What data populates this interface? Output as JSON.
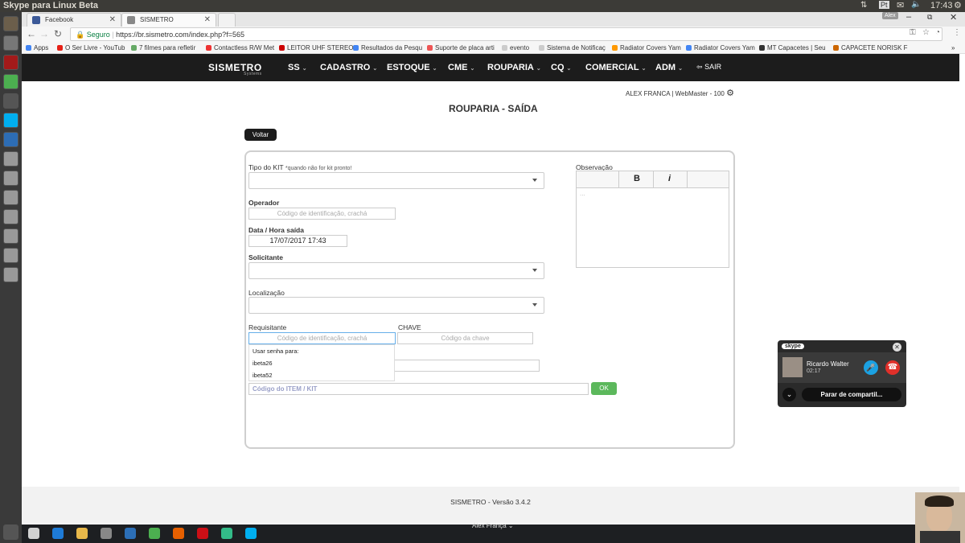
{
  "window_title": "Skype para Linux Beta",
  "top_panel": {
    "time": "17:43"
  },
  "tabs": [
    {
      "label": "Facebook"
    },
    {
      "label": "SISMETRO"
    }
  ],
  "address": {
    "secure_label": "Seguro",
    "url": "https://br.sismetro.com/index.php?f=565"
  },
  "bookmarks": [
    {
      "label": "Apps"
    },
    {
      "label": "O Ser Livre - YouTub"
    },
    {
      "label": "7 filmes para refletir"
    },
    {
      "label": "Contactless R/W Met"
    },
    {
      "label": "LEITOR UHF STEREO"
    },
    {
      "label": "Resultados da Pesqu"
    },
    {
      "label": "Suporte de placa arti"
    },
    {
      "label": "evento"
    },
    {
      "label": "Sistema de Notificaç"
    },
    {
      "label": "Radiator Covers Yam"
    },
    {
      "label": "Radiator Covers Yam"
    },
    {
      "label": "MT Capacetes | Seu"
    },
    {
      "label": "CAPACETE NORISK F"
    }
  ],
  "site": {
    "logo": "SISMETRO",
    "logo_sub": "Systems",
    "menu": [
      {
        "label": "SS"
      },
      {
        "label": "CADASTRO"
      },
      {
        "label": "ESTOQUE"
      },
      {
        "label": "CME"
      },
      {
        "label": "ROUPARIA"
      },
      {
        "label": "CQ"
      },
      {
        "label": "COMERCIAL"
      },
      {
        "label": "ADM"
      }
    ],
    "logout": "SAIR",
    "user_info": "ALEX FRANCA | WebMaster - 100"
  },
  "page": {
    "title": "ROUPARIA - SAÍDA",
    "back_button": "Voltar"
  },
  "form": {
    "tipo_kit_label": "Tipo do KIT",
    "tipo_kit_hint": "*quando não for kit pronto!",
    "operador_label": "Operador",
    "operador_placeholder": "Código de identificação, crachá",
    "data_label": "Data / Hora saída",
    "data_value": "17/07/2017 17:43",
    "solicitante_label": "Solicitante",
    "localizacao_label": "Localização",
    "requisitante_label": "Requisitante",
    "requisitante_placeholder": "Código de identificação, crachá",
    "chave_label": "CHAVE",
    "chave_placeholder": "Código da chave",
    "item_placeholder": "Código do ITEM / KIT",
    "ok_button": "OK",
    "observacao_label": "Observação",
    "bold_btn": "B",
    "italic_btn": "i",
    "editor_placeholder": "..."
  },
  "autocomplete": [
    {
      "label": "Usar senha para:"
    },
    {
      "label": "ibeta26"
    },
    {
      "label": "ibeta52"
    }
  ],
  "footer": {
    "text": "SISMETRO - Versão 3.4.2"
  },
  "skype": {
    "brand": "skype",
    "caller": "Ricardo Walter",
    "duration": "02:17",
    "stop_share": "Parar de compartil..."
  },
  "taskbar": {
    "user": "Alex França"
  },
  "colors": {
    "nav_bg": "#1c1c1c",
    "ok_green": "#5cb85c",
    "hangup_red": "#e0302a",
    "mic_blue": "#1ba1e2"
  }
}
